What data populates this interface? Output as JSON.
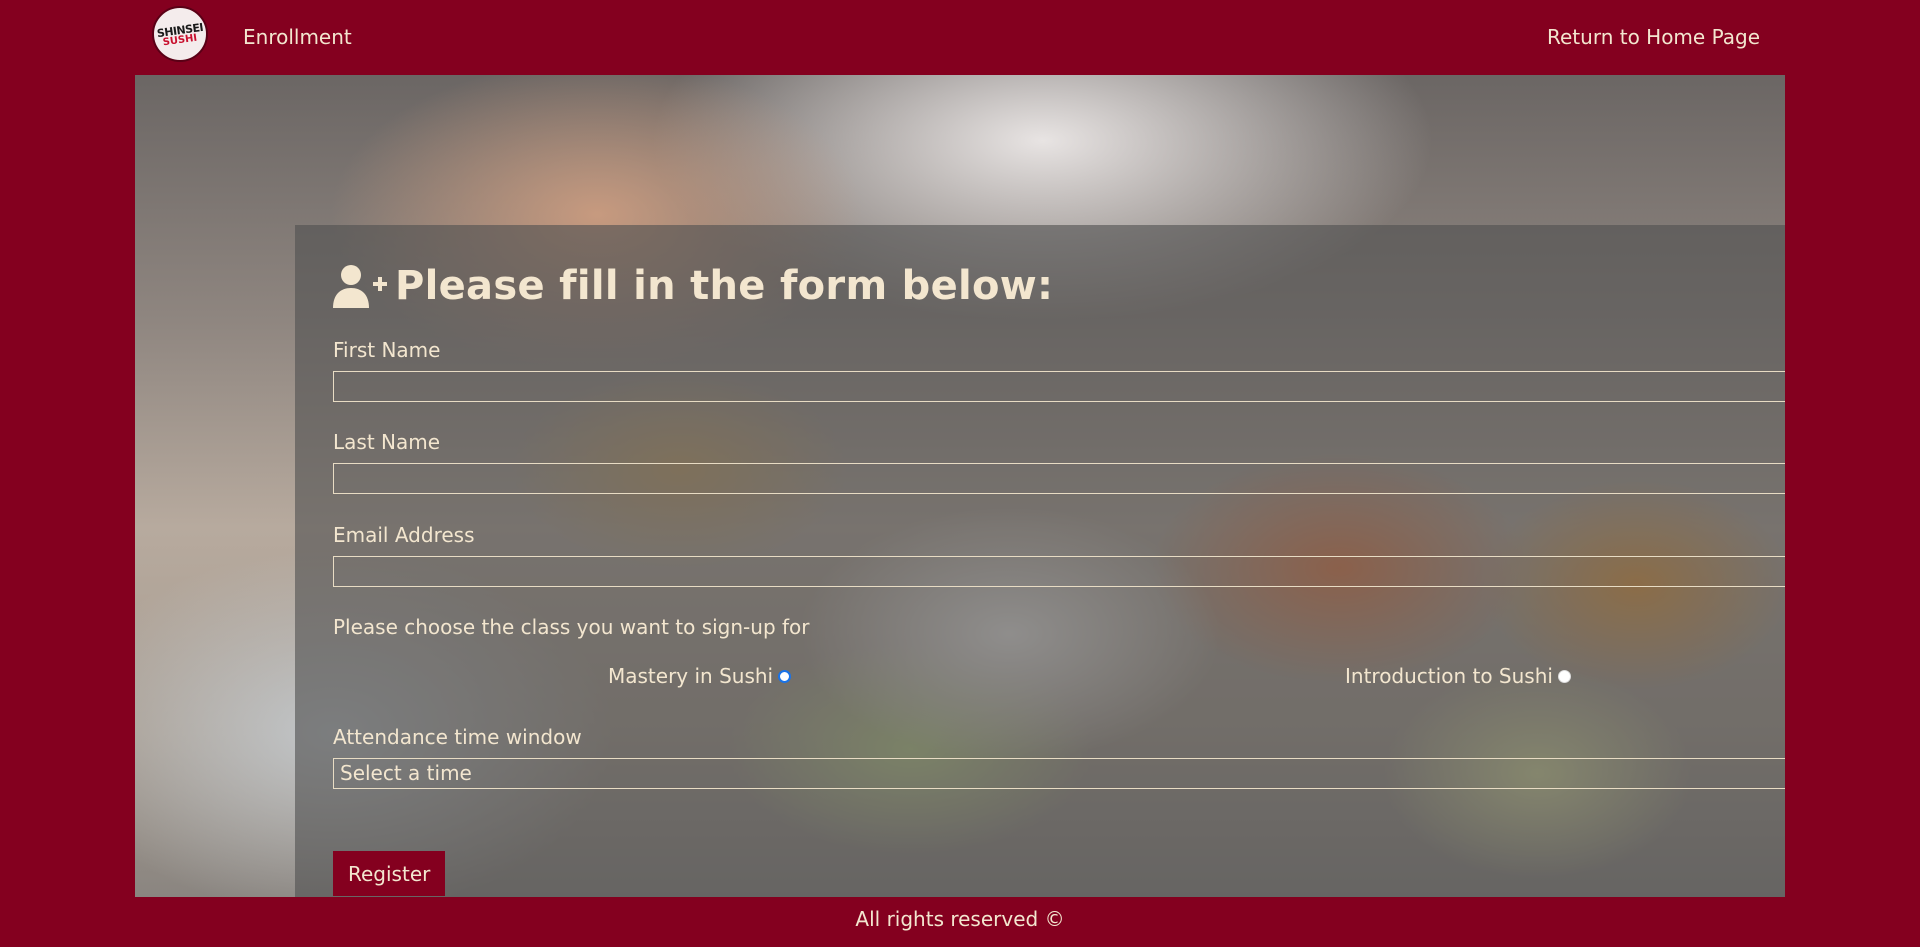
{
  "header": {
    "logo_text": "SHINSEI",
    "logo_subtext": "SUSHI",
    "title": "Enrollment",
    "home_link": "Return to Home Page"
  },
  "form": {
    "heading": "Please fill in the form below:",
    "heading_icon": "user-plus-icon",
    "first_name_label": "First Name",
    "first_name_value": "",
    "last_name_label": "Last Name",
    "last_name_value": "",
    "email_label": "Email Address",
    "email_value": "",
    "class_prompt": "Please choose the class you want to sign-up for",
    "class_options": [
      {
        "label": "Mastery in Sushi",
        "selected": true
      },
      {
        "label": "Introduction to Sushi",
        "selected": false
      }
    ],
    "time_label": "Attendance time window",
    "time_selected": "Select a time",
    "submit_label": "Register"
  },
  "footer": {
    "text": "All rights reserved ©"
  },
  "colors": {
    "brand": "#84001f",
    "text": "#f3e6cf",
    "panel": "rgba(80,80,80,0.62)"
  }
}
